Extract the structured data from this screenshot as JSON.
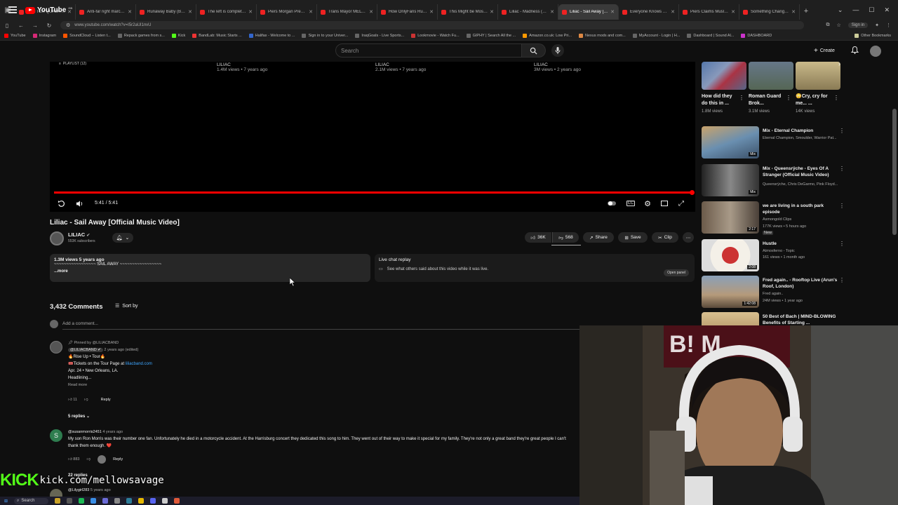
{
  "browser": {
    "tabs": [
      {
        "title": "(BETTER QUALITY) Li..."
      },
      {
        "title": "Anti-far right march c..."
      },
      {
        "title": "Runaway Baby (Bruno..."
      },
      {
        "title": "The left is completely..."
      },
      {
        "title": "Piers Morgan Presses..."
      },
      {
        "title": "Trans Mayor MELTS D..."
      },
      {
        "title": "How OnlyFans Ruined..."
      },
      {
        "title": "This Might be Most In..."
      },
      {
        "title": "Liliac - Madness (Offi..."
      },
      {
        "title": "Liliac - Sail Away [Offi..."
      },
      {
        "title": "Everyone Knows Trou..."
      },
      {
        "title": "Piers Claims Muslims..."
      },
      {
        "title": "Something Changed A..."
      }
    ],
    "url": "www.youtube.com/watch?v=I5r2aUl1nvU",
    "sign_in": "Sign in",
    "bookmarks": [
      "YouTube",
      "Instagram",
      "SoundCloud – Listen t...",
      "Repack games from s...",
      "Kick",
      "BandLab: Music Starts ...",
      "Halifax - Welcome to ...",
      "Sign in to your Univer...",
      "IraqGoals - Live Sports...",
      "Lookmovie - Watch Fu...",
      "GIPHY | Search All the ...",
      "Amazon.co.uk: Low Pri...",
      "Nexus mods and com...",
      "MyAccount - Login | H...",
      "Dashboard | Sound Al...",
      "DASHBOARD"
    ],
    "other_bookmarks": "Other Bookmarks"
  },
  "youtube": {
    "search_placeholder": "Search",
    "create_label": "Create",
    "endcards": [
      {
        "channel": "LILIAC",
        "meta": "1.4M views • 7 years ago"
      },
      {
        "channel": "LILIAC",
        "meta": "2.1M views • 7 years ago"
      },
      {
        "channel": "LILIAC",
        "meta": "3M views • 2 years ago"
      }
    ],
    "playlist_badge": "PLAYLIST (12)",
    "progress_fraction": 1.0,
    "timecode": "5:41 / 5:41",
    "video_title": "Liliac - Sail Away [Official Music Video]",
    "channel_name": "LILIAC",
    "subscribers": "553K subscribers",
    "likes": "36K",
    "dislikes": "568",
    "share": "Share",
    "save": "Save",
    "clip": "Clip",
    "description": {
      "meta": "1.3M views  5 years ago",
      "text": "~~~~~~~~~~~~~~~~~ SAIL AWAY ~~~~~~~~~~~~~~~~~",
      "more": "...more"
    },
    "live_chat": {
      "title": "Live chat replay",
      "subtitle": "See what others said about this video while it was live.",
      "button": "Open panel"
    },
    "comments": {
      "count": "3,432 Comments",
      "sort": "Sort by",
      "add_placeholder": "Add a comment...",
      "items": [
        {
          "pinned": "Pinned by @LILIACBAND",
          "author": "@LILIACBAND",
          "time": "2 years ago (edited)",
          "lines": [
            "🔥Rise Up • Tour🔥",
            "🎟️Tickets on the Tour Page at",
            "Apr. 24 • New Orleans, LA.",
            "Headlining..."
          ],
          "link": "liliacband.com",
          "read_more": "Read more",
          "likes": "11",
          "reply": "Reply",
          "replies": "5 replies"
        },
        {
          "author": "@susanmorris2451",
          "time": "4 years ago",
          "text": "My son Ron Morris was their number one fan. Unfortunately he died in a motorcycle accident. At the Harrisburg concert they dedicated this song to him. They went out of their way to make it special for my family. They're not only a great band they're great people I can't",
          "text2": "thank them enough. ❤️",
          "likes": "883",
          "reply": "Reply",
          "replies": "22 replies"
        },
        {
          "author": "@Lilygirl283",
          "time": "5 years ago"
        }
      ]
    },
    "shorts": [
      {
        "title": "How did they do this in ...",
        "views": "1.8M views"
      },
      {
        "title": "Roman Guard Brok...",
        "views": "3.1M views"
      },
      {
        "title": "😳Cry, cry for me... ...",
        "views": "14K views"
      }
    ],
    "related": [
      {
        "title": "Mix - Eternal Champion",
        "channel": "Eternal Champion, Smoulder, Warrior Pat...",
        "meta": "",
        "duration": "Mix"
      },
      {
        "title": "Mix - Queensrÿche - Eyes Of A Stranger (Official Music Video)",
        "channel": "Queensrÿche, Chris DeGarmo, Pink Floyd...",
        "meta": "",
        "duration": "Mix"
      },
      {
        "title": "we are living in a south park episode",
        "channel": "Asmongold Clips",
        "meta": "177K views • 5 hours ago",
        "badge": "New",
        "duration": "2:17"
      },
      {
        "title": "Hustle",
        "channel": "Atmosferno - Topic",
        "meta": "161 views • 1 month ago",
        "duration": "2:08"
      },
      {
        "title": "Fred again.. - Rooftop Live (Arun's Roof, London)",
        "channel": "Fred again..",
        "meta": "24M views • 1 year ago",
        "duration": "1:42:08"
      },
      {
        "title": "50 Best of Bach | MIND-BLOWING Benefits of Starting ...",
        "channel": "",
        "meta": "",
        "duration": ""
      }
    ]
  },
  "overlay": {
    "kick_logo": "KICK",
    "kick_url": "kick.com/mellowsavage"
  },
  "taskbar": {
    "search": "Search"
  },
  "colors": {
    "accent_red": "#ff0000",
    "kick_green": "#53fc18",
    "link_blue": "#3ea6ff"
  }
}
